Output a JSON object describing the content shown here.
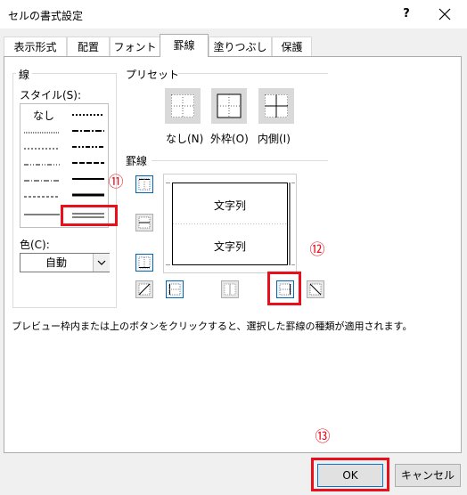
{
  "window": {
    "title": "セルの書式設定",
    "help": "?",
    "close": "✕"
  },
  "tabs": [
    "表示形式",
    "配置",
    "フォント",
    "罫線",
    "塗りつぶし",
    "保護"
  ],
  "active_tab": "罫線",
  "line_section": {
    "title": "線",
    "style_label": "スタイル(S):",
    "none_label": "なし",
    "color_label": "色(C):",
    "color_value": "自動"
  },
  "preset_section": {
    "title": "プリセット",
    "none": "なし(N)",
    "outline": "外枠(O)",
    "inside": "内側(I)"
  },
  "border_section": {
    "title": "罫線",
    "preview_text_top": "文字列",
    "preview_text_bottom": "文字列"
  },
  "hint": "プレビュー枠内または上のボタンをクリックすると、選択した罫線の種類が適用されます。",
  "markers": {
    "m11": "⑪",
    "m12": "⑫",
    "m13": "⑬"
  },
  "buttons": {
    "ok": "OK",
    "cancel": "キャンセル"
  },
  "colors": {
    "highlight": "#e8101c",
    "selected_border": "#0a64ad"
  }
}
